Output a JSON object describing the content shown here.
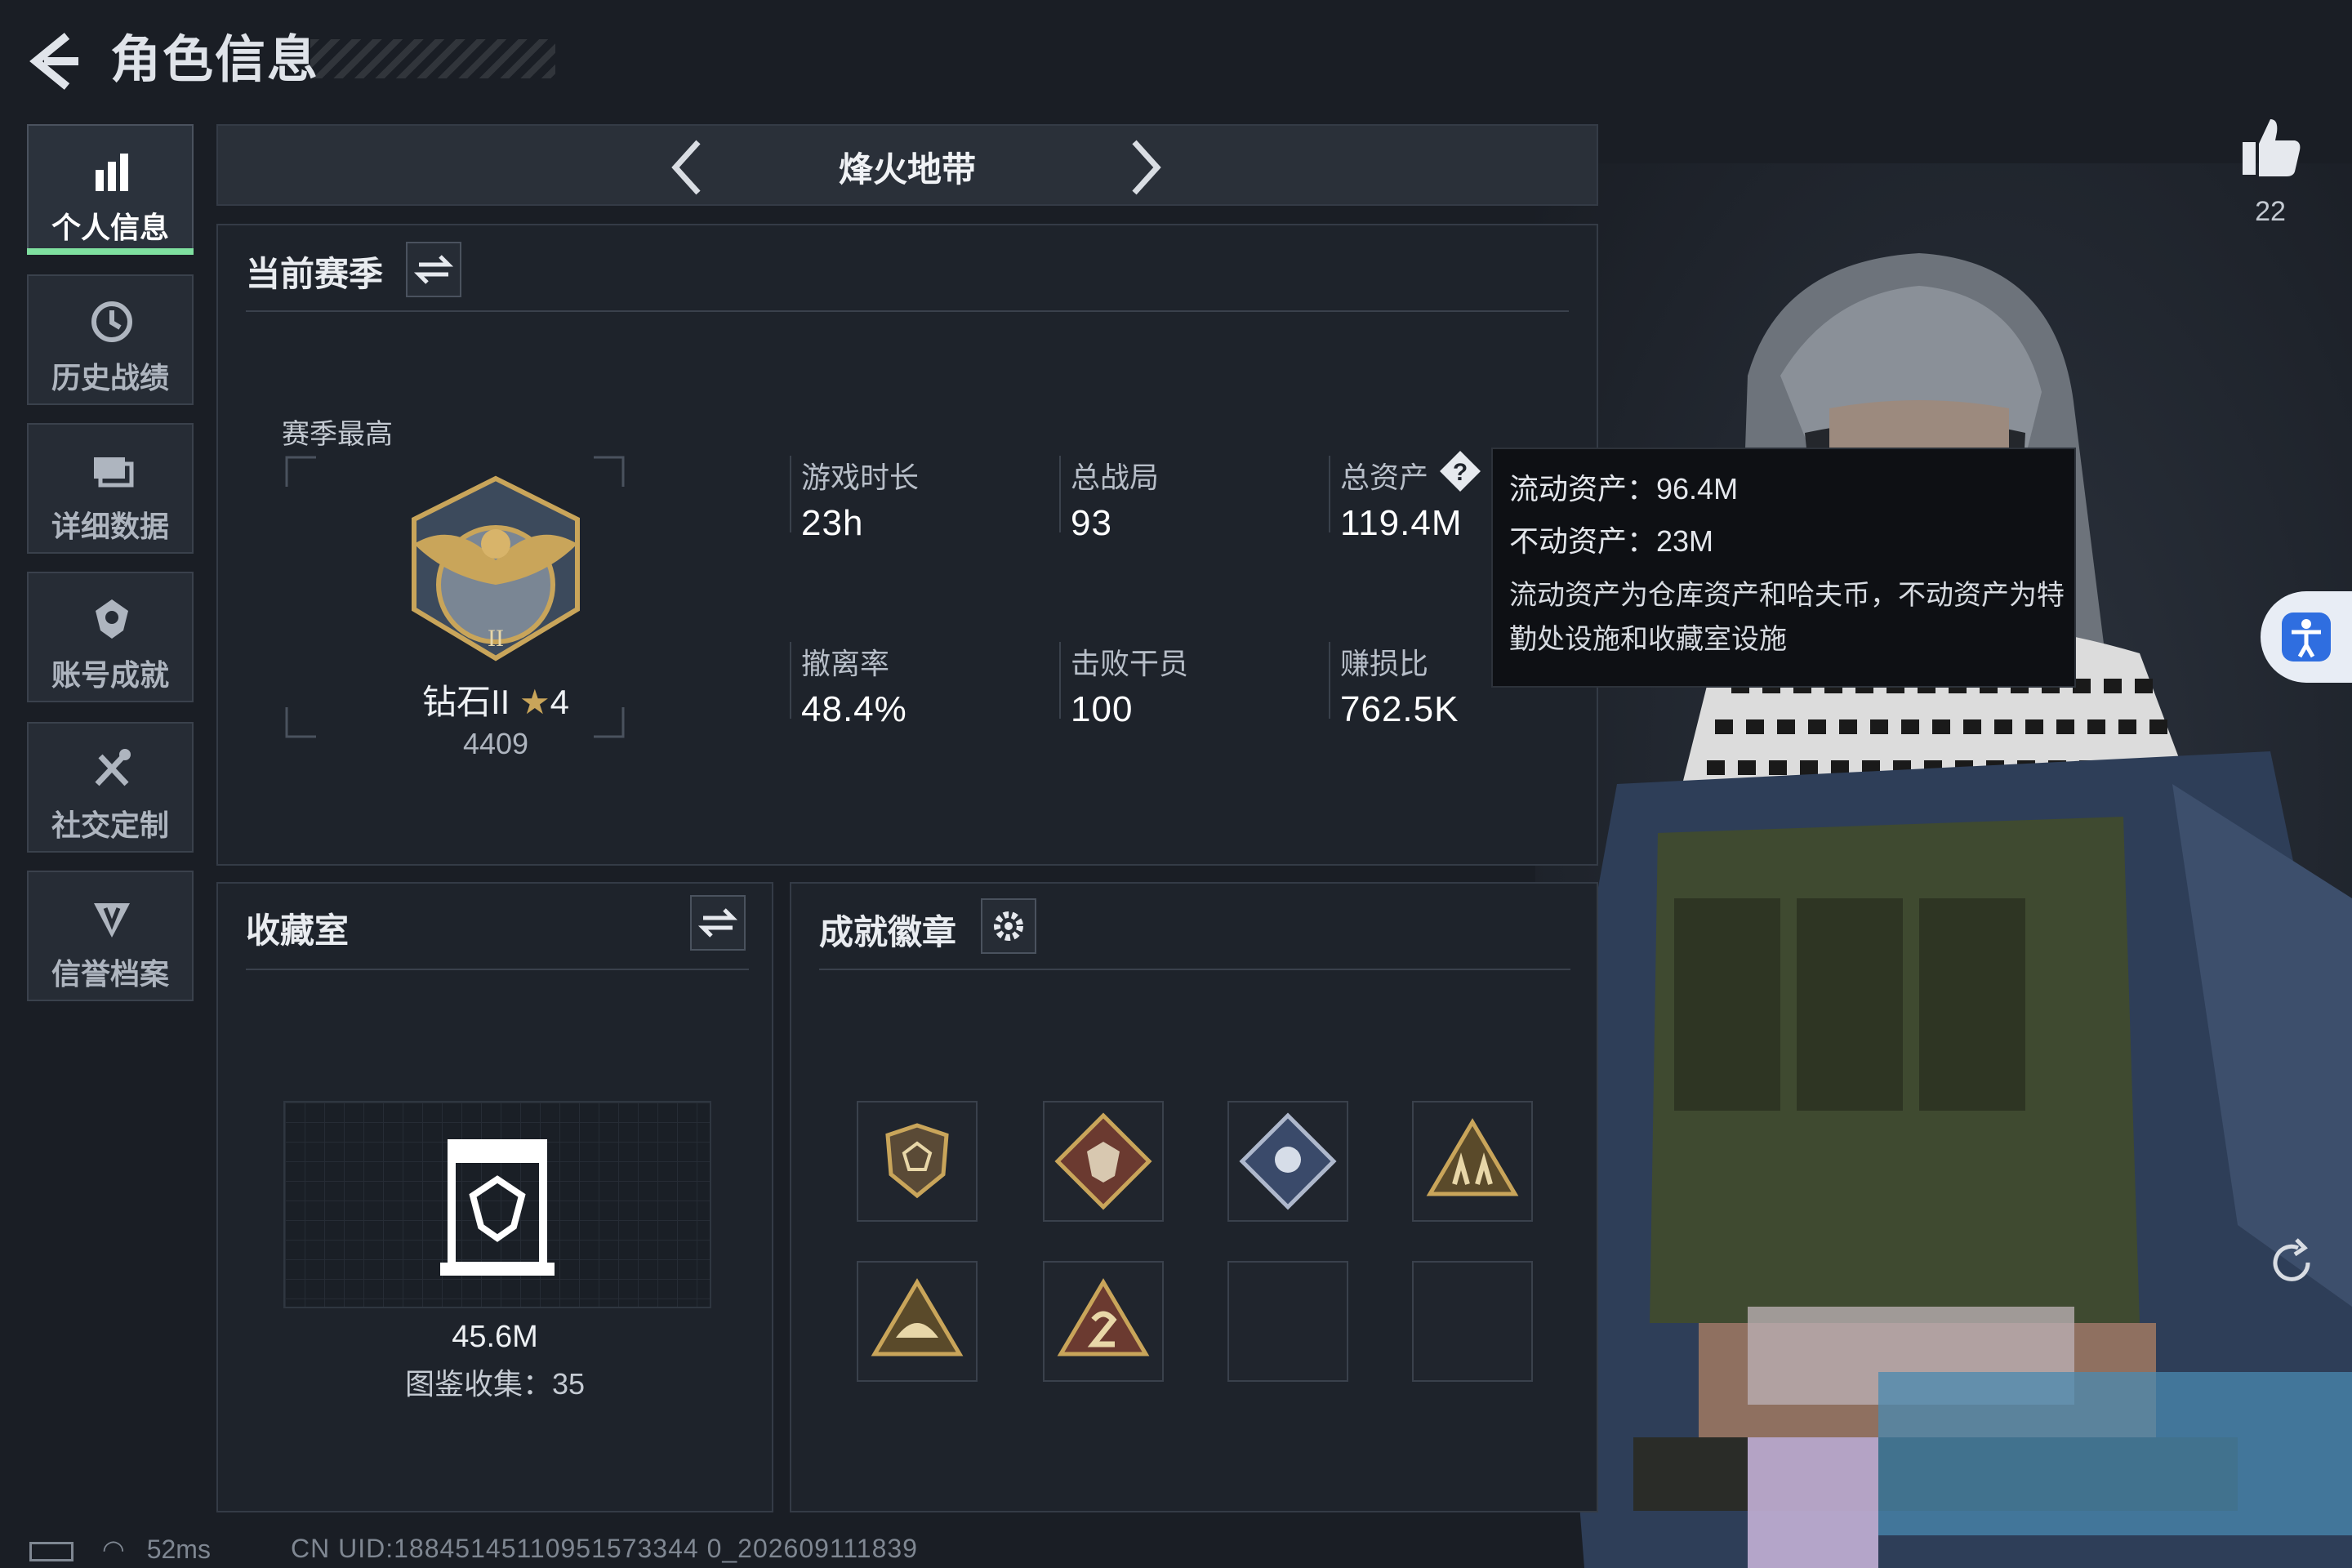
{
  "header": {
    "title": "角色信息"
  },
  "sidebar": {
    "items": [
      {
        "label": "个人信息",
        "icon": "bar-chart-icon",
        "active": true
      },
      {
        "label": "历史战绩",
        "icon": "history-icon"
      },
      {
        "label": "详细数据",
        "icon": "data-icon"
      },
      {
        "label": "账号成就",
        "icon": "achievement-icon"
      },
      {
        "label": "社交定制",
        "icon": "tools-icon"
      },
      {
        "label": "信誉档案",
        "icon": "credit-icon"
      }
    ]
  },
  "mode": {
    "name": "烽火地带"
  },
  "season": {
    "title": "当前赛季",
    "best_label": "赛季最高",
    "rank_name": "钻石II",
    "rank_stars": "4",
    "rank_score": "4409",
    "stats": [
      {
        "label": "游戏时长",
        "value": "23h"
      },
      {
        "label": "总战局",
        "value": "93"
      },
      {
        "label": "总资产",
        "value": "119.4M"
      },
      {
        "label": "撤离率",
        "value": "48.4%"
      },
      {
        "label": "击败干员",
        "value": "100"
      },
      {
        "label": "赚损比",
        "value": "762.5K"
      }
    ]
  },
  "tooltip": {
    "liquid": "流动资产：96.4M",
    "fixed": "不动资产：23M",
    "note": "流动资产为仓库资产和哈夫币，不动资产为特勤处设施和收藏室设施"
  },
  "collection": {
    "title": "收藏室",
    "value": "45.6M",
    "catalog": "图鉴收集：35"
  },
  "badges": {
    "title": "成就徽章"
  },
  "likes": {
    "count": "22"
  },
  "status": {
    "ping": "52ms",
    "uid": "CN UID:18845145110951573344 0_202609111839"
  },
  "colors": {
    "accent": "#7fe0a0",
    "panel": "#1e232b",
    "gold": "#c9a55a"
  }
}
